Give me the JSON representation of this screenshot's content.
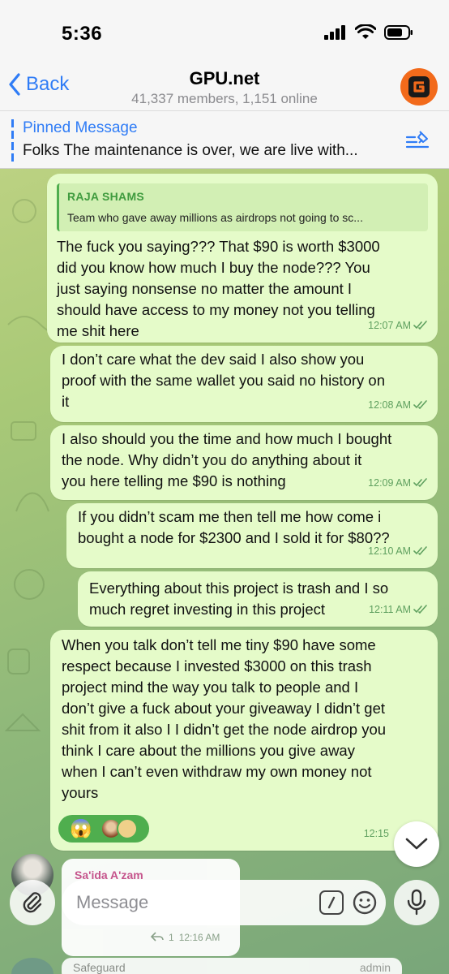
{
  "status": {
    "time": "5:36"
  },
  "header": {
    "back_label": "Back",
    "title": "GPU.net",
    "subtitle": "41,337 members, 1,151 online"
  },
  "pinned": {
    "label": "Pinned Message",
    "text": "Folks The maintenance is over, we are live with..."
  },
  "messages": [
    {
      "reply_name": "RAJA SHAMS",
      "reply_text": "Team who gave away millions as airdrops not going to sc...",
      "text": "The fuck you saying??? That $90 is worth $3000\ndid you know how much I buy the node??? You\njust saying nonsense no matter the amount I\nshould have access to my money not you telling\nme shit here",
      "time": "12:07 AM"
    },
    {
      "text": "I don’t care what the dev said I also show you\nproof with the same wallet you said no history on\nit",
      "time": "12:08 AM"
    },
    {
      "text": "I also should you the time and how much I bought\nthe node. Why didn’t you do anything about it\nyou here telling me $90 is nothing",
      "time": "12:09 AM"
    },
    {
      "text": "If you didn’t scam me then tell me how come i\nbought a node for $2300 and I sold it for $80??",
      "time": "12:10 AM"
    },
    {
      "text": "Everything about this project is trash and I so\nmuch regret investing in this project",
      "time": "12:11 AM"
    },
    {
      "text": "When you talk don’t tell me tiny $90 have some\nrespect because I invested $3000 on this trash\nproject mind the way you talk to people and I\ndon’t give a fuck about your giveaway I didn’t get\nshit from it also I I didn’t get the node airdrop you\nthink I care about the millions you give away\nwhen I can’t even withdraw my own money not\nyours",
      "time": "12:15",
      "reaction_emoji": "😱"
    }
  ],
  "incoming": {
    "sender": "Sa'ida A'zam",
    "reply_count": "1",
    "time": "12:16 AM"
  },
  "composer": {
    "placeholder": "Message"
  },
  "peek": {
    "sender": "Safeguard",
    "role": "admin"
  },
  "colors": {
    "accent": "#2f7cf6",
    "outgoing_bubble": "#e5fbc9",
    "check_green": "#5fa05f",
    "reply_bar": "#4fae4e"
  }
}
